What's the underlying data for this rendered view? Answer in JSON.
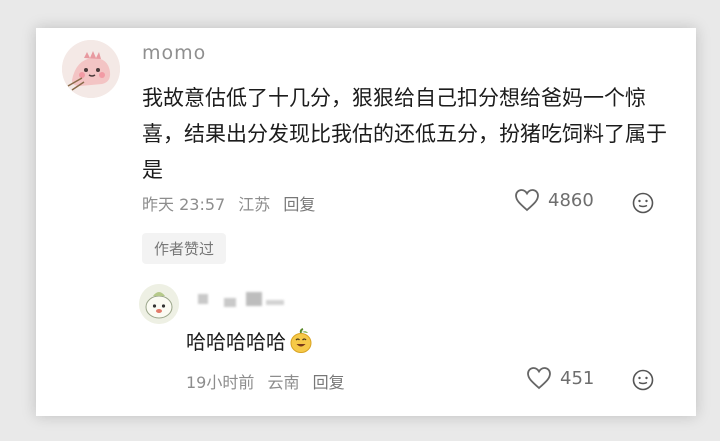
{
  "comment": {
    "username": "momo",
    "text": "我故意估低了十几分，狠狠给自己扣分想给爸妈一个惊喜，结果出分发现比我估的还低五分，扮猪吃饲料了属于是",
    "date": "昨天 23:57",
    "location": "江苏",
    "reply_label": "回复",
    "likes": "4860",
    "author_tag": "作者赞过"
  },
  "reply": {
    "text": "哈哈哈哈哈",
    "time": "19小时前",
    "location": "云南",
    "reply_label": "回复",
    "likes": "451"
  },
  "icons": {
    "like": "heart-outline-icon",
    "emoji": "smile-icon"
  }
}
